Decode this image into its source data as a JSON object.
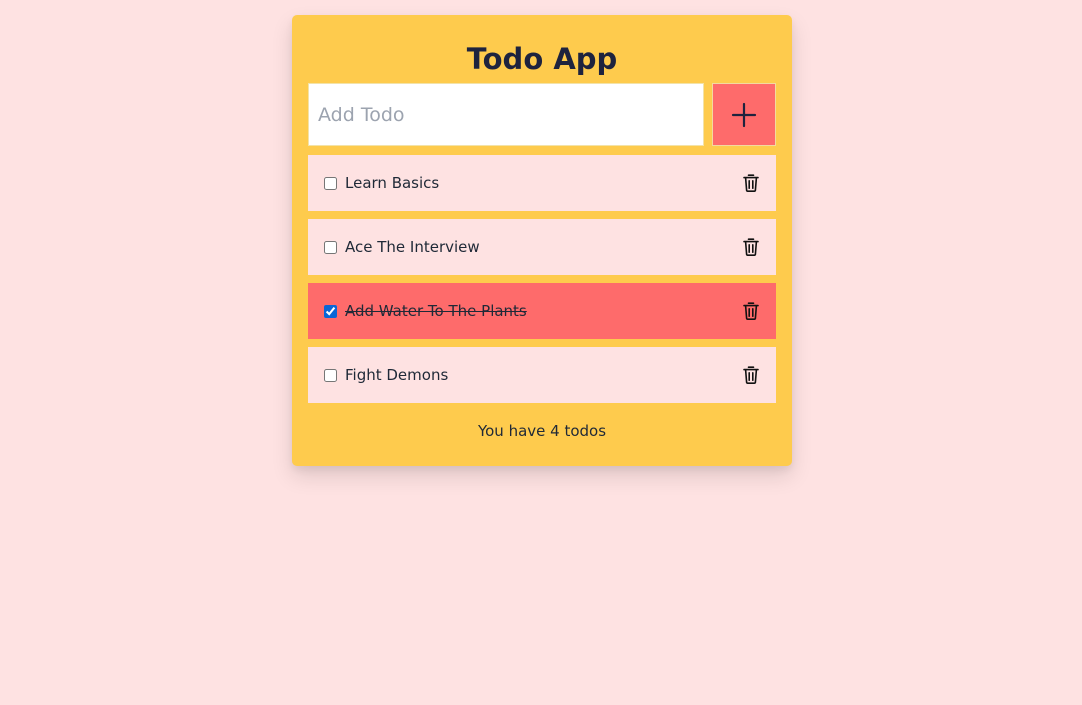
{
  "app": {
    "title": "Todo App"
  },
  "add_todo": {
    "placeholder": "Add Todo",
    "value": "",
    "button_icon": "plus-icon"
  },
  "todos": [
    {
      "label": "Learn Basics",
      "completed": false,
      "delete_icon": "trash-icon"
    },
    {
      "label": "Ace The Interview",
      "completed": false,
      "delete_icon": "trash-icon"
    },
    {
      "label": "Add Water To The Plants",
      "completed": true,
      "delete_icon": "trash-icon"
    },
    {
      "label": "Fight Demons",
      "completed": false,
      "delete_icon": "trash-icon"
    }
  ],
  "footer": {
    "count_text": "You have 4 todos"
  },
  "colors": {
    "background": "#fee2e2",
    "card": "#fecb4d",
    "accent": "#fe6b6b",
    "title_text": "#1e233e"
  }
}
